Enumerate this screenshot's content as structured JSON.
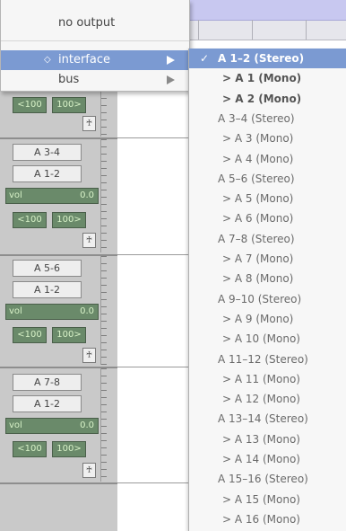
{
  "routing_menu": {
    "items": [
      {
        "label": "no output",
        "has_submenu": false,
        "selected": false
      },
      {
        "label": "interface",
        "has_submenu": true,
        "selected": true
      },
      {
        "label": "bus",
        "has_submenu": true,
        "selected": false
      }
    ],
    "bullet": "◇",
    "selection_color": "#7b9ad2"
  },
  "interface_submenu": {
    "check": "✓",
    "items": [
      {
        "label": "A 1–2 (Stereo)",
        "checked": true
      },
      {
        "label": "> A 1 (Mono)"
      },
      {
        "label": "> A 2 (Mono)"
      },
      {
        "label": "A 3–4 (Stereo)"
      },
      {
        "label": "> A 3 (Mono)"
      },
      {
        "label": "> A 4 (Mono)"
      },
      {
        "label": "A 5–6 (Stereo)"
      },
      {
        "label": "> A 5 (Mono)"
      },
      {
        "label": "> A 6 (Mono)"
      },
      {
        "label": "A 7–8 (Stereo)"
      },
      {
        "label": "> A 7 (Mono)"
      },
      {
        "label": "> A 8 (Mono)"
      },
      {
        "label": "A 9–10 (Stereo)"
      },
      {
        "label": "> A 9 (Mono)"
      },
      {
        "label": "> A 10 (Mono)"
      },
      {
        "label": "A 11–12 (Stereo)"
      },
      {
        "label": "> A 11 (Mono)"
      },
      {
        "label": "> A 12 (Mono)"
      },
      {
        "label": "A 13–14 (Stereo)"
      },
      {
        "label": "> A 13 (Mono)"
      },
      {
        "label": "> A 14 (Mono)"
      },
      {
        "label": "A 15–16 (Stereo)"
      },
      {
        "label": "> A 15 (Mono)"
      },
      {
        "label": "> A 16 (Mono)"
      }
    ]
  },
  "strips": [
    {
      "pan_left": "<100",
      "pan_right": "100>"
    },
    {
      "input": "A 3-4",
      "output": "A 1-2",
      "vol_label": "vol",
      "vol_value": "0.0",
      "pan_left": "<100",
      "pan_right": "100>"
    },
    {
      "input": "A 5-6",
      "output": "A 1-2",
      "vol_label": "vol",
      "vol_value": "0.0",
      "pan_left": "<100",
      "pan_right": "100>"
    },
    {
      "input": "A 7-8",
      "output": "A 1-2",
      "vol_label": "vol",
      "vol_value": "0.0",
      "pan_left": "<100",
      "pan_right": "100>"
    }
  ],
  "lock_icon": "lock-icon",
  "lock_glyph": "♰"
}
